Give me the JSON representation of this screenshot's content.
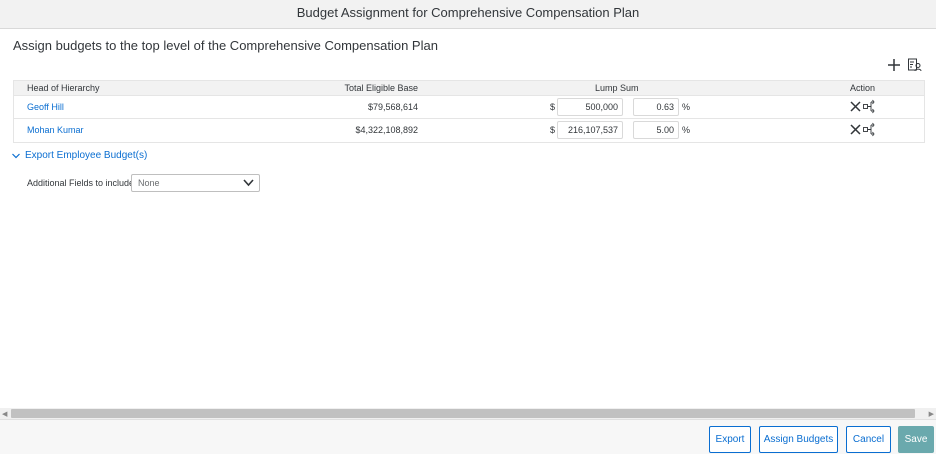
{
  "dialog": {
    "title": "Budget Assignment for Comprehensive Compensation Plan",
    "subtitle": "Assign budgets to the top level of the Comprehensive Compensation Plan"
  },
  "toolbar": {
    "add_icon": "plus-icon",
    "person_icon": "person-list-icon"
  },
  "table": {
    "headers": {
      "head_of_hierarchy": "Head of Hierarchy",
      "total_eligible_base": "Total Eligible Base",
      "lump_sum": "Lump Sum",
      "action": "Action"
    },
    "rows": [
      {
        "name": "Geoff Hill",
        "total_eligible_base": "$79,568,614",
        "currency": "$",
        "amount": "500,000",
        "percent": "0.63",
        "percent_sign": "%"
      },
      {
        "name": "Mohan Kumar",
        "total_eligible_base": "$4,322,108,892",
        "currency": "$",
        "amount": "216,107,537",
        "percent": "5.00",
        "percent_sign": "%"
      }
    ]
  },
  "export_section": {
    "toggle_label": "Export Employee Budget(s)",
    "additional_fields_label": "Additional Fields to include",
    "select_value": "None"
  },
  "footer": {
    "export": "Export",
    "assign_budgets": "Assign Budgets",
    "cancel": "Cancel",
    "save": "Save"
  },
  "colors": {
    "link": "#0a6ed1",
    "save_button": "#6aa9ad",
    "header_bg": "#f2f2f2"
  }
}
